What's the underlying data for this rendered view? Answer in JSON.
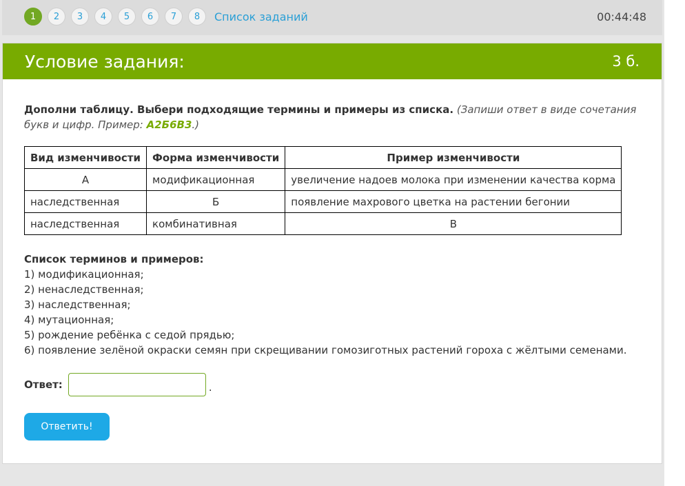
{
  "nav": {
    "steps": [
      "1",
      "2",
      "3",
      "4",
      "5",
      "6",
      "7",
      "8"
    ],
    "active_step": 0,
    "task_list_label": "Список заданий",
    "timer": "00:44:48"
  },
  "card": {
    "title": "Условие задания:",
    "points": "3 б."
  },
  "instruction": {
    "bold": "Дополни таблицу. Выбери подходящие термины и примеры из списка.",
    "italic_before": " (Запиши ответ в виде сочетания букв и цифр. Пример: ",
    "example": "А2Б6В3",
    "italic_after": ".)"
  },
  "table": {
    "headers": [
      "Вид изменчивости",
      "Форма изменчивости",
      "Пример изменчивости"
    ],
    "rows": [
      [
        "А",
        "модификационная",
        "увеличение надоев молока при изменении качества корма"
      ],
      [
        "наследственная",
        "Б",
        "появление махрового цветка на растении бегонии"
      ],
      [
        "наследственная",
        "комбинативная",
        "В"
      ]
    ]
  },
  "terms": {
    "title": "Список терминов и примеров:",
    "items": [
      "1) модификационная;",
      "2) ненаследственная;",
      "3) наследственная;",
      "4) мутационная;",
      "5) рождение ребёнка с седой прядью;",
      "6) появление зелёной окраски семян при скрещивании гомозиготных растений гороха с жёлтыми семенами."
    ]
  },
  "answer": {
    "label": "Ответ:",
    "value": "",
    "dot": "."
  },
  "submit_label": "Ответить!",
  "colors": {
    "accent_green": "#78ab00",
    "link_blue": "#2a9fd6",
    "button_blue": "#1ea9e6"
  }
}
